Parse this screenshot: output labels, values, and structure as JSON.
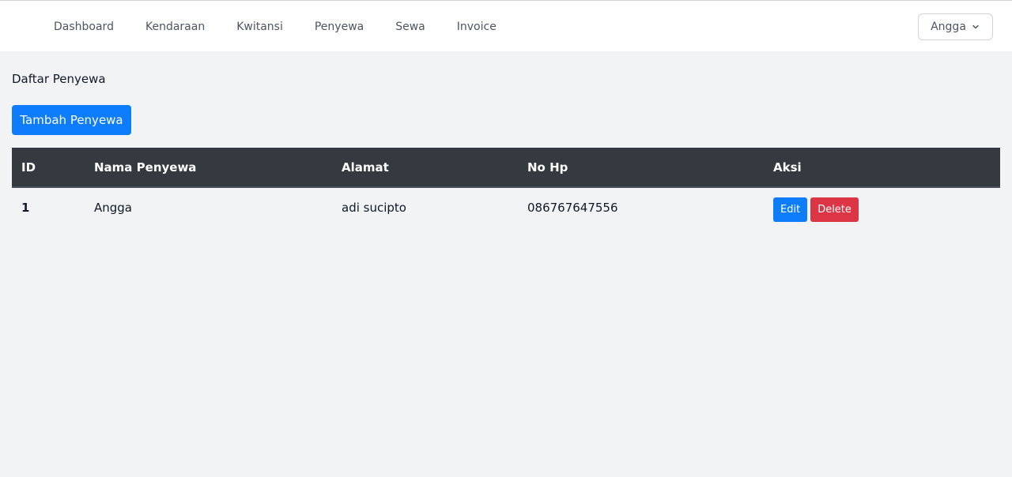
{
  "nav": {
    "items": [
      {
        "label": "Dashboard"
      },
      {
        "label": "Kendaraan"
      },
      {
        "label": "Kwitansi"
      },
      {
        "label": "Penyewa"
      },
      {
        "label": "Sewa"
      },
      {
        "label": "Invoice"
      }
    ],
    "user": {
      "name": "Angga",
      "icon": "chevron-down-icon"
    }
  },
  "page": {
    "title": "Daftar Penyewa",
    "add_button_label": "Tambah Penyewa"
  },
  "table": {
    "headers": [
      "ID",
      "Nama Penyewa",
      "Alamat",
      "No Hp",
      "Aksi"
    ],
    "rows": [
      {
        "id": "1",
        "nama": "Angga",
        "alamat": "adi sucipto",
        "no_hp": "086767647556",
        "edit_label": "Edit",
        "delete_label": "Delete"
      }
    ]
  },
  "colors": {
    "primary": "#0d7dfd",
    "danger": "#dc3545",
    "table_header": "#343a40",
    "background": "#f2f3f5"
  }
}
